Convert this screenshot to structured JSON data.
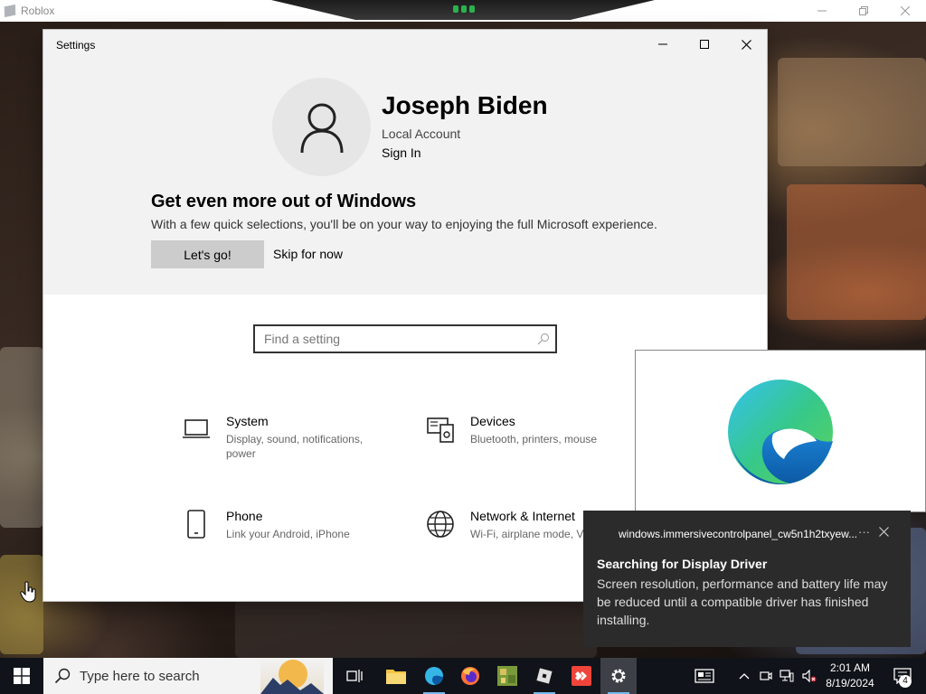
{
  "roblox": {
    "title": "Roblox"
  },
  "settings": {
    "title": "Settings",
    "user": {
      "name": "Joseph Biden",
      "account_type": "Local Account",
      "sign_in": "Sign In"
    },
    "promo": {
      "title": "Get even more out of Windows",
      "text": "With a few quick selections, you'll be on your way to enjoying the full Microsoft experience.",
      "primary_button": "Let's go!",
      "secondary_link": "Skip for now"
    },
    "search": {
      "placeholder": "Find a setting"
    },
    "categories": [
      {
        "name": "System",
        "description": "Display, sound, notifications, power",
        "icon": "laptop-icon"
      },
      {
        "name": "Devices",
        "description": "Bluetooth, printers, mouse",
        "icon": "devices-icon"
      },
      {
        "name": "Phone",
        "description": "Link your Android, iPhone",
        "icon": "phone-icon"
      },
      {
        "name": "Network & Internet",
        "description": "Wi-Fi, airplane mode, V",
        "icon": "globe-icon"
      }
    ]
  },
  "toast": {
    "app": "windows.immersivecontrolpanel_cw5n1h2txyew...",
    "more": "···",
    "title": "Searching for Display Driver",
    "body": "Screen resolution, performance and battery life may be reduced until a compatible driver has finished installing."
  },
  "taskbar": {
    "search_text": "Type here to search",
    "apps": [
      "task-view",
      "file-explorer",
      "edge",
      "firefox",
      "minecraft",
      "roblox",
      "anydesk",
      "settings"
    ],
    "clock": {
      "time": "2:01 AM",
      "date": "8/19/2024"
    },
    "notification_count": "4"
  },
  "colors": {
    "accent": "#0078d4",
    "taskbar": "#101319",
    "toast_bg": "#2b2b2b"
  }
}
